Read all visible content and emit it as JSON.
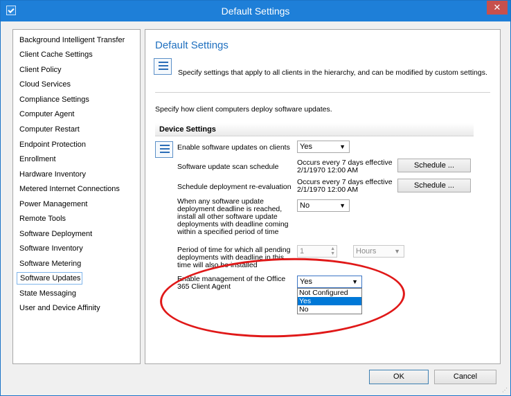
{
  "window": {
    "title": "Default Settings",
    "close": "✕",
    "app_icon": "settings-app-icon"
  },
  "nav": {
    "items": [
      {
        "label": "Background Intelligent Transfer",
        "selected": false
      },
      {
        "label": "Client Cache Settings",
        "selected": false
      },
      {
        "label": "Client Policy",
        "selected": false
      },
      {
        "label": "Cloud Services",
        "selected": false
      },
      {
        "label": "Compliance Settings",
        "selected": false
      },
      {
        "label": "Computer Agent",
        "selected": false
      },
      {
        "label": "Computer Restart",
        "selected": false
      },
      {
        "label": "Endpoint Protection",
        "selected": false
      },
      {
        "label": "Enrollment",
        "selected": false
      },
      {
        "label": "Hardware Inventory",
        "selected": false
      },
      {
        "label": "Metered Internet Connections",
        "selected": false
      },
      {
        "label": "Power Management",
        "selected": false
      },
      {
        "label": "Remote Tools",
        "selected": false
      },
      {
        "label": "Software Deployment",
        "selected": false
      },
      {
        "label": "Software Inventory",
        "selected": false
      },
      {
        "label": "Software Metering",
        "selected": false
      },
      {
        "label": "Software Updates",
        "selected": true
      },
      {
        "label": "State Messaging",
        "selected": false
      },
      {
        "label": "User and Device Affinity",
        "selected": false
      }
    ]
  },
  "content": {
    "heading": "Default Settings",
    "description": "Specify settings that apply to all clients in the hierarchy, and can be modified by custom settings.",
    "intro": "Specify how client computers deploy software updates.",
    "section_title": "Device Settings",
    "rows": {
      "enable_updates": {
        "label": "Enable software updates on clients",
        "value": "Yes"
      },
      "scan_schedule": {
        "label": "Software update scan schedule",
        "value_line1": "Occurs every 7 days effective",
        "value_line2": "2/1/1970 12:00 AM",
        "button": "Schedule ..."
      },
      "deploy_reeval": {
        "label": "Schedule deployment re-evaluation",
        "value_line1": "Occurs every 7 days effective",
        "value_line2": "2/1/1970 12:00 AM",
        "button": "Schedule ..."
      },
      "deadline": {
        "label": "When any software update deployment deadline is reached, install all other software update deployments with deadline coming within a specified period of time",
        "value": "No"
      },
      "period": {
        "label": "Period of time for which all pending deployments with deadline in this time will also be installed",
        "value": "1",
        "unit": "Hours"
      },
      "office365": {
        "label": "Enable management of the Office 365 Client Agent",
        "value": "Yes",
        "options": [
          {
            "label": "Not Configured",
            "selected": false
          },
          {
            "label": "Yes",
            "selected": true
          },
          {
            "label": "No",
            "selected": false
          }
        ]
      }
    }
  },
  "footer": {
    "ok": "OK",
    "cancel": "Cancel"
  },
  "annotation": {
    "color": "#e01818",
    "shape": "ellipse"
  }
}
